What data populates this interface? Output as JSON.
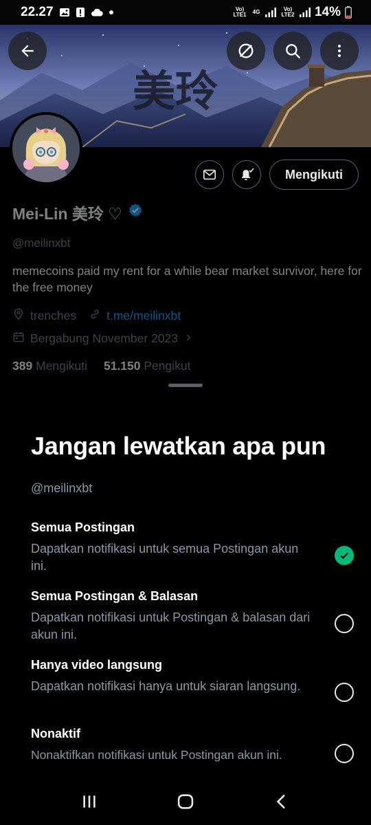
{
  "status_bar": {
    "time": "22.27",
    "sim1": "Vo) LTE1",
    "network": "4G",
    "sim2": "Vo) LTE2",
    "battery": "14%"
  },
  "banner": {
    "calligraphy": "美玲"
  },
  "profile": {
    "name": "Mei-Lin 美玲 ♡",
    "handle": "@meilinxbt",
    "bio": "memecoins paid my rent for a while  bear market survivor, here for the free money",
    "location": "trenches",
    "link": "t.me/meilinxbt",
    "joined": "Bergabung November 2023",
    "following_count": "389",
    "following_label": "Mengikuti",
    "followers_count": "51.150",
    "followers_label": "Pengikut",
    "follow_button": "Mengikuti"
  },
  "sheet": {
    "title": "Jangan lewatkan apa pun",
    "handle": "@meilinxbt",
    "options": [
      {
        "title": "Semua Postingan",
        "desc": "Dapatkan notifikasi untuk semua Postingan akun ini.",
        "selected": true
      },
      {
        "title": "Semua Postingan & Balasan",
        "desc": "Dapatkan notifikasi untuk Postingan & balasan dari akun ini.",
        "selected": false
      },
      {
        "title": "Hanya video langsung",
        "desc": "Dapatkan notifikasi hanya untuk siaran langsung.",
        "selected": false
      },
      {
        "title": "Nonaktif",
        "desc": "Nonaktifkan notifikasi untuk Postingan akun ini.",
        "selected": false
      }
    ]
  },
  "colors": {
    "accent_blue": "#1d9bf0",
    "check_green": "#00ba7c",
    "secondary_text": "#71767b"
  },
  "icons": [
    "back-arrow-icon",
    "grok-icon",
    "search-icon",
    "more-vertical-icon",
    "mail-icon",
    "bell-icon",
    "verified-badge-icon",
    "location-icon",
    "link-icon",
    "calendar-icon",
    "chevron-right-icon",
    "check-icon",
    "recents-icon",
    "home-icon",
    "back-icon"
  ]
}
